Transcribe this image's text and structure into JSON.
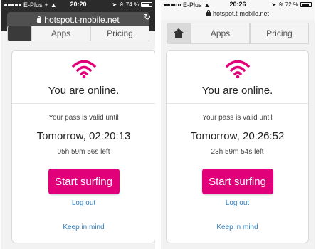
{
  "colors": {
    "brand": "#e2007a",
    "link": "#2f7fbf"
  },
  "screens": [
    {
      "status": {
        "carrier": "E-Plus",
        "network": "+",
        "time": "20:20",
        "battery": "74 %"
      },
      "url": "hotspot.t-mobile.net",
      "nav": {
        "apps": "Apps",
        "pricing": "Pricing"
      },
      "card": {
        "title": "You are online.",
        "valid_label": "Your pass is valid until",
        "until": "Tomorrow, 02:20:13",
        "remaining": "05h 59m 56s left",
        "button": "Start surfing",
        "logout": "Log out",
        "keep": "Keep in mind"
      }
    },
    {
      "status": {
        "carrier": "E-Plus",
        "network": "",
        "time": "20:26",
        "battery": "72 %"
      },
      "url": "hotspot.t-mobile.net",
      "nav": {
        "apps": "Apps",
        "pricing": "Pricing"
      },
      "card": {
        "title": "You are online.",
        "valid_label": "Your pass is valid until",
        "until": "Tomorrow, 20:26:52",
        "remaining": "23h 59m 54s left",
        "button": "Start surfing",
        "logout": "Log out",
        "keep": "Keep in mind"
      }
    }
  ]
}
